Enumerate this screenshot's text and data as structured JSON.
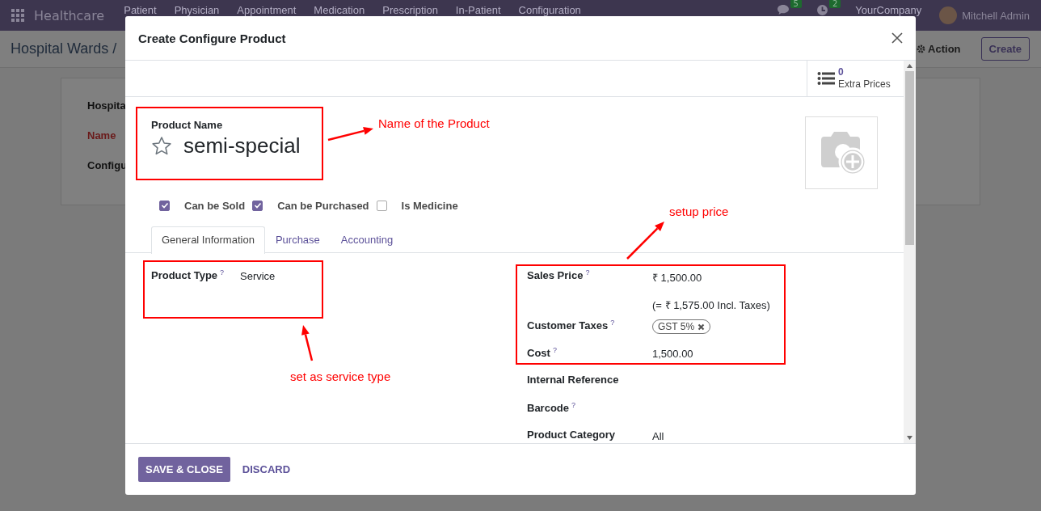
{
  "navbar": {
    "app": "Healthcare",
    "menu": [
      "Patient",
      "Physician",
      "Appointment",
      "Medication",
      "Prescription",
      "In-Patient",
      "Configuration"
    ],
    "chat_count": "5",
    "activity_count": "2",
    "company": "YourCompany",
    "user": "Mitchell Admin"
  },
  "control_panel": {
    "breadcrumb": "Hospital Wards /",
    "action": "Action",
    "create": "Create"
  },
  "background_form": {
    "fields": [
      {
        "label": "Hospita",
        "invalid": false
      },
      {
        "label": "Name",
        "invalid": true
      },
      {
        "label": "Configu",
        "invalid": false
      }
    ]
  },
  "dialog": {
    "title": "Create Configure Product",
    "extra_prices": {
      "count": "0",
      "label": "Extra Prices"
    },
    "name_label": "Product Name",
    "name": "semi-special",
    "favorite": false,
    "options": [
      {
        "label": "Can be Sold",
        "checked": true
      },
      {
        "label": "Can be Purchased",
        "checked": true
      },
      {
        "label": "Is Medicine",
        "checked": false
      }
    ],
    "tabs": [
      {
        "label": "General Information",
        "selected": true
      },
      {
        "label": "Purchase",
        "selected": false
      },
      {
        "label": "Accounting",
        "selected": false
      }
    ],
    "left_fields": [
      {
        "kind": "text",
        "label": "Product Type",
        "help": "?",
        "value": "Service"
      }
    ],
    "right_fields": [
      {
        "kind": "text",
        "label": "Sales Price",
        "help": "?",
        "value": "₹ 1,500.00"
      },
      {
        "kind": "note",
        "value": "(= ₹ 1,575.00 Incl. Taxes)"
      },
      {
        "kind": "tags",
        "label": "Customer Taxes",
        "help": "?",
        "tags": [
          "GST 5%"
        ]
      },
      {
        "kind": "text",
        "label": "Cost",
        "help": "?",
        "value": "1,500.00"
      },
      {
        "kind": "text",
        "label": "Internal Reference"
      },
      {
        "kind": "text",
        "label": "Barcode",
        "help": "?"
      },
      {
        "kind": "text",
        "label": "Product Category",
        "value": "All"
      }
    ],
    "buttons": [
      {
        "label": "SAVE & CLOSE",
        "kind": "primary"
      },
      {
        "label": "DISCARD",
        "kind": "link"
      }
    ]
  },
  "callouts": [
    {
      "text": "Name of the Product"
    },
    {
      "text": "set as service type"
    },
    {
      "text": "setup price"
    }
  ]
}
